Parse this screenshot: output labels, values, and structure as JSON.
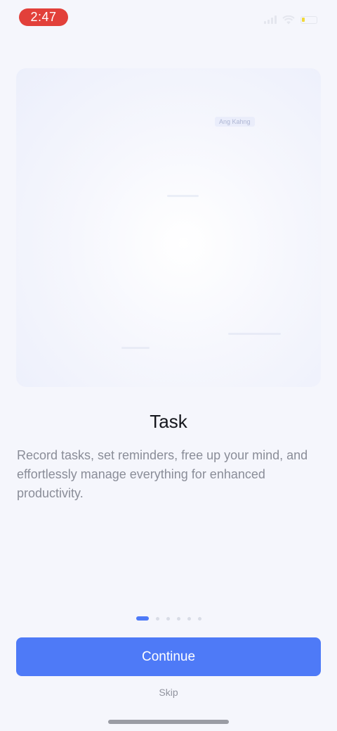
{
  "status_bar": {
    "time": "2:47",
    "icons": [
      "cellular-signal-icon",
      "wifi-icon",
      "battery-icon"
    ]
  },
  "illustration": {
    "ghost_label": "Ang Kahng"
  },
  "onboarding": {
    "title": "Task",
    "description": "Record tasks, set reminders, free up your mind, and effortlessly manage everything for enhanced productivity.",
    "page_count": 6,
    "current_page": 1
  },
  "actions": {
    "continue_label": "Continue",
    "skip_label": "Skip"
  },
  "colors": {
    "accent": "#4e7af7",
    "time_pill": "#e2403a",
    "background": "#f5f6fc"
  }
}
